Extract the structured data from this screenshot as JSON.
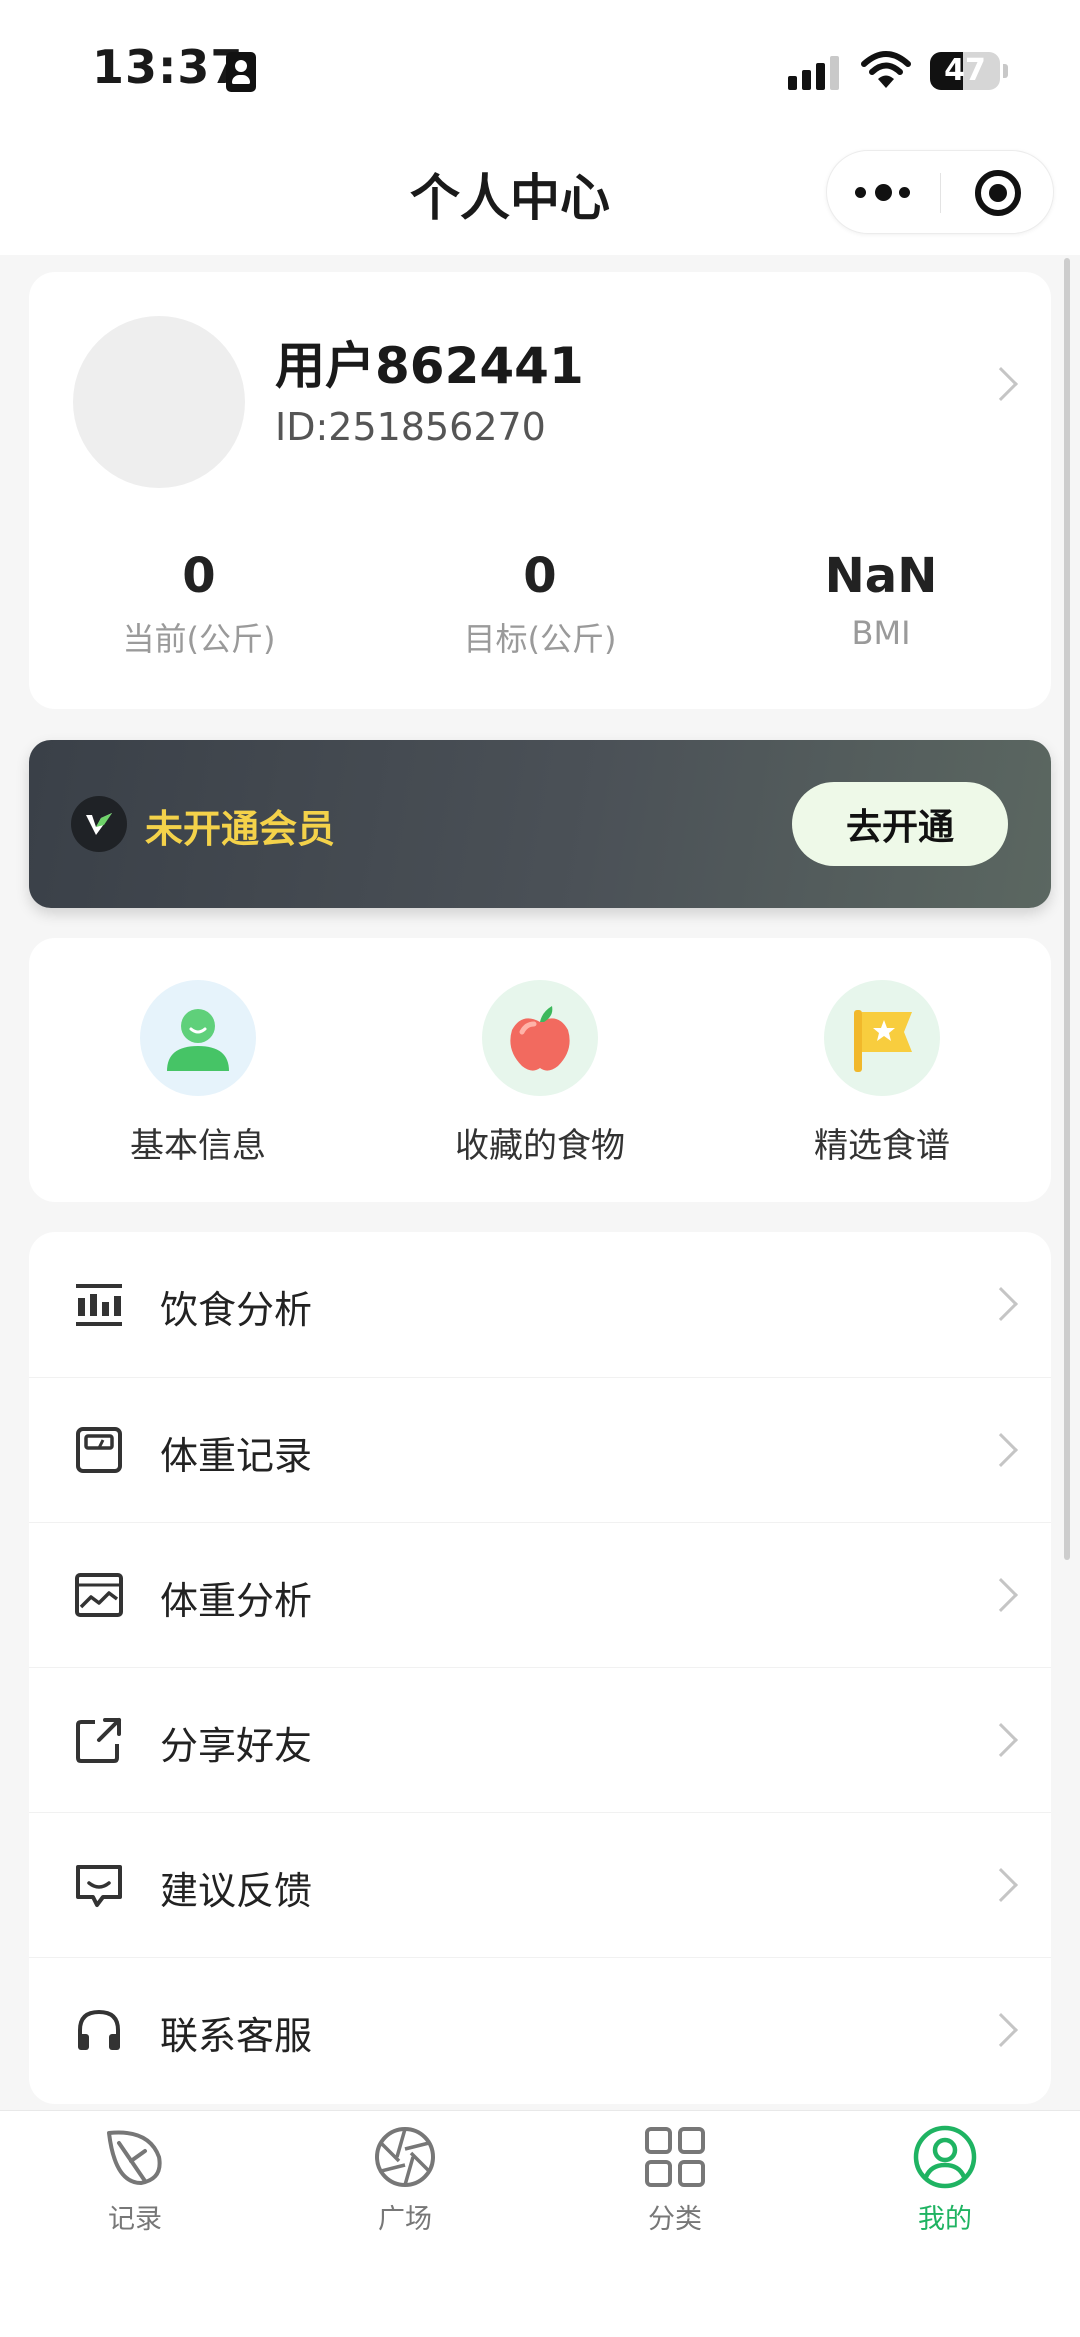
{
  "status_bar": {
    "time": "13:37",
    "battery": "47",
    "battery_level": 0.47
  },
  "nav": {
    "title": "个人中心"
  },
  "profile": {
    "name": "用户862441",
    "id": "ID:251856270",
    "stats": [
      {
        "value": "0",
        "label": "当前(公斤)"
      },
      {
        "value": "0",
        "label": "目标(公斤)"
      },
      {
        "value": "NaN",
        "label": "BMI"
      }
    ]
  },
  "vip": {
    "status": "未开通会员",
    "button": "去开通"
  },
  "quick_actions": [
    {
      "label": "基本信息",
      "icon": "user-icon"
    },
    {
      "label": "收藏的食物",
      "icon": "apple-icon"
    },
    {
      "label": "精选食谱",
      "icon": "star-flag-icon"
    }
  ],
  "menu": [
    {
      "label": "饮食分析",
      "icon": "diet-analysis-icon"
    },
    {
      "label": "体重记录",
      "icon": "scale-icon"
    },
    {
      "label": "体重分析",
      "icon": "chart-icon"
    },
    {
      "label": "分享好友",
      "icon": "share-icon"
    },
    {
      "label": "建议反馈",
      "icon": "feedback-icon"
    },
    {
      "label": "联系客服",
      "icon": "headphones-icon"
    }
  ],
  "tabs": [
    {
      "label": "记录",
      "icon": "leaf-icon"
    },
    {
      "label": "广场",
      "icon": "aperture-icon"
    },
    {
      "label": "分类",
      "icon": "grid-icon"
    },
    {
      "label": "我的",
      "icon": "profile-icon"
    }
  ],
  "colors": {
    "accent": "#1fb362",
    "vip_text": "#f4d24a",
    "vip_button_bg": "#eef9e8",
    "page_bg": "#f6f6f6"
  }
}
